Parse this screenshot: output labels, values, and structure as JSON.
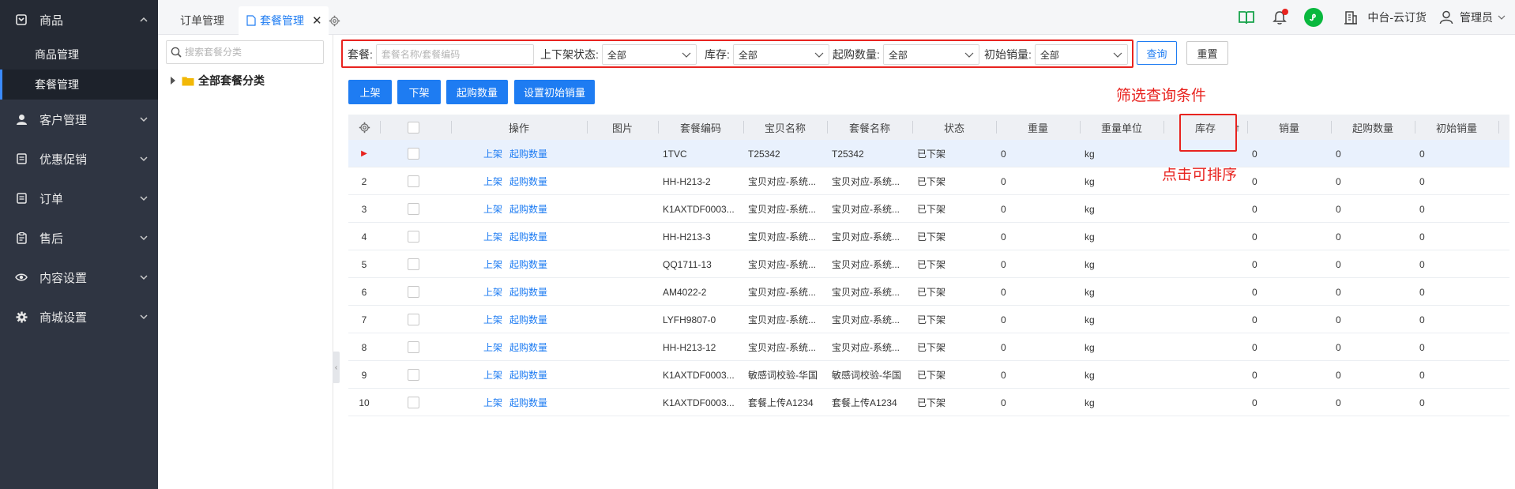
{
  "sidebar": {
    "groups": [
      {
        "label": "商品",
        "icon": "product-icon"
      },
      {
        "label": "客户管理",
        "icon": "user-icon"
      },
      {
        "label": "优惠促销",
        "icon": "promo-icon"
      },
      {
        "label": "订单",
        "icon": "order-icon"
      },
      {
        "label": "售后",
        "icon": "aftersale-icon"
      },
      {
        "label": "内容设置",
        "icon": "eye-icon"
      },
      {
        "label": "商城设置",
        "icon": "gear-icon"
      }
    ],
    "sub_items": [
      "商品管理",
      "套餐管理"
    ]
  },
  "tabs": [
    {
      "label": "订单管理"
    },
    {
      "label": "套餐管理"
    }
  ],
  "topbar": {
    "store_name": "中台-云订货",
    "user_name": "管理员"
  },
  "tree": {
    "search_placeholder": "搜索套餐分类",
    "root_label": "全部套餐分类"
  },
  "filters": {
    "package_label": "套餐:",
    "package_placeholder": "套餐名称/套餐编码",
    "status_label": "上下架状态:",
    "status_value": "全部",
    "stock_label": "库存:",
    "stock_value": "全部",
    "min_qty_label": "起购数量:",
    "min_qty_value": "全部",
    "init_sales_label": "初始销量:",
    "init_sales_value": "全部",
    "query_label": "查询",
    "reset_label": "重置"
  },
  "actions": [
    "上架",
    "下架",
    "起购数量",
    "设置初始销量"
  ],
  "annotations": {
    "filter_note": "筛选查询条件",
    "sort_note": "点击可排序"
  },
  "table": {
    "columns": [
      "操作",
      "图片",
      "套餐编码",
      "宝贝名称",
      "套餐名称",
      "状态",
      "重量",
      "重量单位",
      "库存",
      "销量",
      "起购数量",
      "初始销量"
    ],
    "sort_indicator": "↑",
    "row_actions": [
      "上架",
      "起购数量"
    ],
    "rows": [
      {
        "idx": "",
        "code": "1TVC",
        "item_name": "T25342",
        "package_name": "T25342",
        "status": "已下架",
        "weight": "0",
        "unit": "kg",
        "stock": "",
        "sales": "0",
        "min_qty": "0",
        "init_sales": "0"
      },
      {
        "idx": "2",
        "code": "HH-H213-2",
        "item_name": "宝贝对应-系统...",
        "package_name": "宝贝对应-系统...",
        "status": "已下架",
        "weight": "0",
        "unit": "kg",
        "stock": "",
        "sales": "0",
        "min_qty": "0",
        "init_sales": "0"
      },
      {
        "idx": "3",
        "code": "K1AXTDF0003...",
        "item_name": "宝贝对应-系统...",
        "package_name": "宝贝对应-系统...",
        "status": "已下架",
        "weight": "0",
        "unit": "kg",
        "stock": "",
        "sales": "0",
        "min_qty": "0",
        "init_sales": "0"
      },
      {
        "idx": "4",
        "code": "HH-H213-3",
        "item_name": "宝贝对应-系统...",
        "package_name": "宝贝对应-系统...",
        "status": "已下架",
        "weight": "0",
        "unit": "kg",
        "stock": "",
        "sales": "0",
        "min_qty": "0",
        "init_sales": "0"
      },
      {
        "idx": "5",
        "code": "QQ1711-13",
        "item_name": "宝贝对应-系统...",
        "package_name": "宝贝对应-系统...",
        "status": "已下架",
        "weight": "0",
        "unit": "kg",
        "stock": "",
        "sales": "0",
        "min_qty": "0",
        "init_sales": "0"
      },
      {
        "idx": "6",
        "code": "AM4022-2",
        "item_name": "宝贝对应-系统...",
        "package_name": "宝贝对应-系统...",
        "status": "已下架",
        "weight": "0",
        "unit": "kg",
        "stock": "",
        "sales": "0",
        "min_qty": "0",
        "init_sales": "0"
      },
      {
        "idx": "7",
        "code": "LYFH9807-0",
        "item_name": "宝贝对应-系统...",
        "package_name": "宝贝对应-系统...",
        "status": "已下架",
        "weight": "0",
        "unit": "kg",
        "stock": "",
        "sales": "0",
        "min_qty": "0",
        "init_sales": "0"
      },
      {
        "idx": "8",
        "code": "HH-H213-12",
        "item_name": "宝贝对应-系统...",
        "package_name": "宝贝对应-系统...",
        "status": "已下架",
        "weight": "0",
        "unit": "kg",
        "stock": "",
        "sales": "0",
        "min_qty": "0",
        "init_sales": "0"
      },
      {
        "idx": "9",
        "code": "K1AXTDF0003...",
        "item_name": "敏感词校验-华国",
        "package_name": "敏感词校验-华国",
        "status": "已下架",
        "weight": "0",
        "unit": "kg",
        "stock": "",
        "sales": "0",
        "min_qty": "0",
        "init_sales": "0"
      },
      {
        "idx": "10",
        "code": "K1AXTDF0003...",
        "item_name": "套餐上传A1234",
        "package_name": "套餐上传A1234",
        "status": "已下架",
        "weight": "0",
        "unit": "kg",
        "stock": "",
        "sales": "0",
        "min_qty": "0",
        "init_sales": "0"
      }
    ]
  },
  "colors": {
    "sidebar_bg": "#2f3542",
    "primary": "#1e7cf2",
    "annotation_red": "#e8231f",
    "wechat_green": "#09b83e"
  }
}
